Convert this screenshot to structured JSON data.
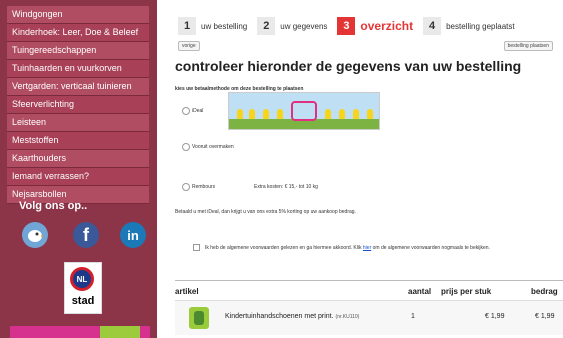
{
  "sidebar": {
    "menu": [
      "Windgongen",
      "Kinderhoek: Leer, Doe & Beleef",
      "Tuingereedschappen",
      "Tuinhaarden en vuurkorven",
      "Vertgarden: verticaal tuinieren",
      "Sfeerverlichting",
      "Leisteen",
      "Meststoffen",
      "Kaarthouders",
      "Iemand verrassen?",
      "Nejsarsbollen"
    ],
    "follow_title": "Volg ons op..",
    "social": {
      "facebook": "f",
      "linkedin": "in"
    },
    "nl_badge": {
      "code": "NL",
      "text": "stad"
    }
  },
  "steps": [
    {
      "num": "1",
      "label": "uw bestelling"
    },
    {
      "num": "2",
      "label": "uw gegevens"
    },
    {
      "num": "3",
      "label": "overzicht"
    },
    {
      "num": "4",
      "label": "bestelling geplaatst"
    }
  ],
  "buttons": {
    "prev": "vorige",
    "place": "bestelling plaatsen"
  },
  "title": "controleer hieronder de gegevens van uw bestelling",
  "payment": {
    "title": "kies uw betaalmethode om deze bestelling te plaatsen",
    "options": [
      {
        "label": "iDeal"
      },
      {
        "label": "Vooruit overmaken"
      },
      {
        "label": "Rembours"
      }
    ],
    "extra_cost": "Extra kosten: € 15,- tot 10 kg",
    "note": "Betaald u met iDeal, dan krijgt u van ons extra 5% korting op uw aankoop bedrag."
  },
  "terms": {
    "text": "Ik heb de algemene voorwaarden gelezen en ga hiermee akkoord. Klik",
    "link": "hier",
    "text_after": "om de algemene voorwaarden nogmaals te bekijken."
  },
  "table": {
    "headers": {
      "article": "artikel",
      "qty": "aantal",
      "price": "prijs per stuk",
      "amount": "bedrag"
    },
    "rows": [
      {
        "name": "Kindertuinhandschoenen met print.",
        "code": "(nr.KU110)",
        "qty": "1",
        "price": "€ 1,99",
        "amount": "€ 1,99"
      }
    ]
  },
  "colors": {
    "sidebar_bg": "#8c3448",
    "menu_item": "#b04d63",
    "active_step": "#e43535",
    "link": "#1a55c5"
  }
}
